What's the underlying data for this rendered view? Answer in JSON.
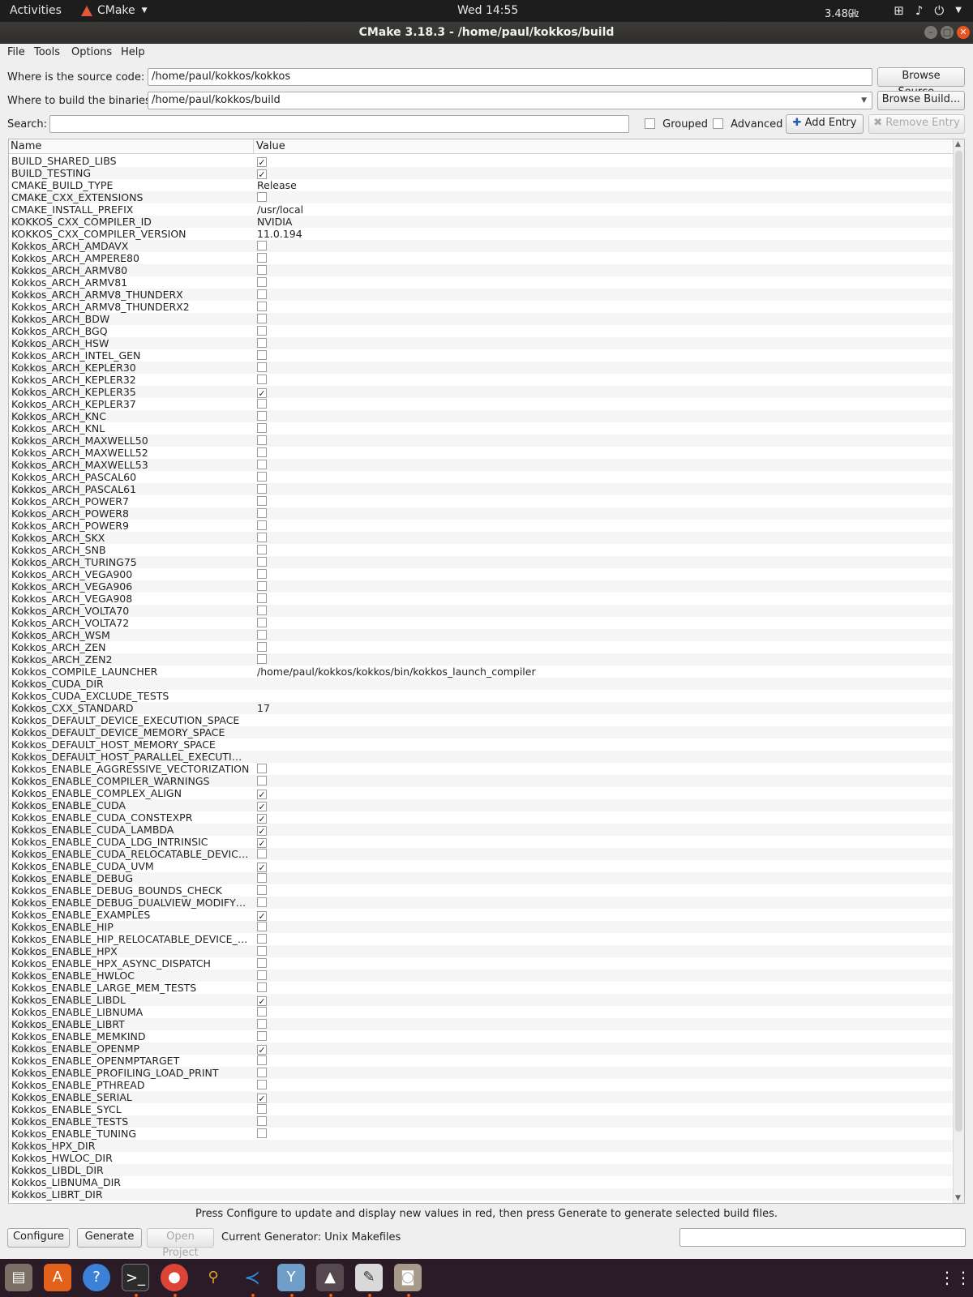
{
  "topbar": {
    "activities": "Activities",
    "app_name": "CMake",
    "clock": "Wed 14:55",
    "cpu": "3.48㎓",
    "tray_icons": [
      "network-icon",
      "volume-icon",
      "power-icon",
      "chevron-down-icon"
    ]
  },
  "window": {
    "title": "CMake 3.18.3 - /home/paul/kokkos/build"
  },
  "menu": [
    "File",
    "Tools",
    "Options",
    "Help"
  ],
  "source": {
    "label": "Where is the source code:",
    "value": "/home/paul/kokkos/kokkos",
    "browse": "Browse Source..."
  },
  "build": {
    "label": "Where to build the binaries:",
    "value": "/home/paul/kokkos/build",
    "browse": "Browse Build..."
  },
  "search": {
    "label": "Search:",
    "value": "",
    "grouped": "Grouped",
    "advanced": "Advanced",
    "add_entry": "Add Entry",
    "remove_entry": "Remove Entry"
  },
  "table": {
    "col_name": "Name",
    "col_value": "Value",
    "rows": [
      {
        "name": "BUILD_SHARED_LIBS",
        "type": "bool",
        "checked": true
      },
      {
        "name": "BUILD_TESTING",
        "type": "bool",
        "checked": true
      },
      {
        "name": "CMAKE_BUILD_TYPE",
        "type": "text",
        "value": "Release"
      },
      {
        "name": "CMAKE_CXX_EXTENSIONS",
        "type": "bool",
        "checked": false
      },
      {
        "name": "CMAKE_INSTALL_PREFIX",
        "type": "text",
        "value": "/usr/local"
      },
      {
        "name": "KOKKOS_CXX_COMPILER_ID",
        "type": "text",
        "value": "NVIDIA"
      },
      {
        "name": "KOKKOS_CXX_COMPILER_VERSION",
        "type": "text",
        "value": "11.0.194"
      },
      {
        "name": "Kokkos_ARCH_AMDAVX",
        "type": "bool",
        "checked": false
      },
      {
        "name": "Kokkos_ARCH_AMPERE80",
        "type": "bool",
        "checked": false
      },
      {
        "name": "Kokkos_ARCH_ARMV80",
        "type": "bool",
        "checked": false
      },
      {
        "name": "Kokkos_ARCH_ARMV81",
        "type": "bool",
        "checked": false
      },
      {
        "name": "Kokkos_ARCH_ARMV8_THUNDERX",
        "type": "bool",
        "checked": false
      },
      {
        "name": "Kokkos_ARCH_ARMV8_THUNDERX2",
        "type": "bool",
        "checked": false
      },
      {
        "name": "Kokkos_ARCH_BDW",
        "type": "bool",
        "checked": false
      },
      {
        "name": "Kokkos_ARCH_BGQ",
        "type": "bool",
        "checked": false
      },
      {
        "name": "Kokkos_ARCH_HSW",
        "type": "bool",
        "checked": false
      },
      {
        "name": "Kokkos_ARCH_INTEL_GEN",
        "type": "bool",
        "checked": false
      },
      {
        "name": "Kokkos_ARCH_KEPLER30",
        "type": "bool",
        "checked": false
      },
      {
        "name": "Kokkos_ARCH_KEPLER32",
        "type": "bool",
        "checked": false
      },
      {
        "name": "Kokkos_ARCH_KEPLER35",
        "type": "bool",
        "checked": true
      },
      {
        "name": "Kokkos_ARCH_KEPLER37",
        "type": "bool",
        "checked": false
      },
      {
        "name": "Kokkos_ARCH_KNC",
        "type": "bool",
        "checked": false
      },
      {
        "name": "Kokkos_ARCH_KNL",
        "type": "bool",
        "checked": false
      },
      {
        "name": "Kokkos_ARCH_MAXWELL50",
        "type": "bool",
        "checked": false
      },
      {
        "name": "Kokkos_ARCH_MAXWELL52",
        "type": "bool",
        "checked": false
      },
      {
        "name": "Kokkos_ARCH_MAXWELL53",
        "type": "bool",
        "checked": false
      },
      {
        "name": "Kokkos_ARCH_PASCAL60",
        "type": "bool",
        "checked": false
      },
      {
        "name": "Kokkos_ARCH_PASCAL61",
        "type": "bool",
        "checked": false
      },
      {
        "name": "Kokkos_ARCH_POWER7",
        "type": "bool",
        "checked": false
      },
      {
        "name": "Kokkos_ARCH_POWER8",
        "type": "bool",
        "checked": false
      },
      {
        "name": "Kokkos_ARCH_POWER9",
        "type": "bool",
        "checked": false
      },
      {
        "name": "Kokkos_ARCH_SKX",
        "type": "bool",
        "checked": false
      },
      {
        "name": "Kokkos_ARCH_SNB",
        "type": "bool",
        "checked": false
      },
      {
        "name": "Kokkos_ARCH_TURING75",
        "type": "bool",
        "checked": false
      },
      {
        "name": "Kokkos_ARCH_VEGA900",
        "type": "bool",
        "checked": false
      },
      {
        "name": "Kokkos_ARCH_VEGA906",
        "type": "bool",
        "checked": false
      },
      {
        "name": "Kokkos_ARCH_VEGA908",
        "type": "bool",
        "checked": false
      },
      {
        "name": "Kokkos_ARCH_VOLTA70",
        "type": "bool",
        "checked": false
      },
      {
        "name": "Kokkos_ARCH_VOLTA72",
        "type": "bool",
        "checked": false
      },
      {
        "name": "Kokkos_ARCH_WSM",
        "type": "bool",
        "checked": false
      },
      {
        "name": "Kokkos_ARCH_ZEN",
        "type": "bool",
        "checked": false
      },
      {
        "name": "Kokkos_ARCH_ZEN2",
        "type": "bool",
        "checked": false
      },
      {
        "name": "Kokkos_COMPILE_LAUNCHER",
        "type": "text",
        "value": "/home/paul/kokkos/kokkos/bin/kokkos_launch_compiler"
      },
      {
        "name": "Kokkos_CUDA_DIR",
        "type": "text",
        "value": ""
      },
      {
        "name": "Kokkos_CUDA_EXCLUDE_TESTS",
        "type": "text",
        "value": ""
      },
      {
        "name": "Kokkos_CXX_STANDARD",
        "type": "text",
        "value": "17"
      },
      {
        "name": "Kokkos_DEFAULT_DEVICE_EXECUTION_SPACE",
        "type": "text",
        "value": ""
      },
      {
        "name": "Kokkos_DEFAULT_DEVICE_MEMORY_SPACE",
        "type": "text",
        "value": ""
      },
      {
        "name": "Kokkos_DEFAULT_HOST_MEMORY_SPACE",
        "type": "text",
        "value": ""
      },
      {
        "name": "Kokkos_DEFAULT_HOST_PARALLEL_EXECUTION...",
        "type": "text",
        "value": ""
      },
      {
        "name": "Kokkos_ENABLE_AGGRESSIVE_VECTORIZATION",
        "type": "bool",
        "checked": false
      },
      {
        "name": "Kokkos_ENABLE_COMPILER_WARNINGS",
        "type": "bool",
        "checked": false
      },
      {
        "name": "Kokkos_ENABLE_COMPLEX_ALIGN",
        "type": "bool",
        "checked": true
      },
      {
        "name": "Kokkos_ENABLE_CUDA",
        "type": "bool",
        "checked": true
      },
      {
        "name": "Kokkos_ENABLE_CUDA_CONSTEXPR",
        "type": "bool",
        "checked": true
      },
      {
        "name": "Kokkos_ENABLE_CUDA_LAMBDA",
        "type": "bool",
        "checked": true
      },
      {
        "name": "Kokkos_ENABLE_CUDA_LDG_INTRINSIC",
        "type": "bool",
        "checked": true
      },
      {
        "name": "Kokkos_ENABLE_CUDA_RELOCATABLE_DEVICE_...",
        "type": "bool",
        "checked": false
      },
      {
        "name": "Kokkos_ENABLE_CUDA_UVM",
        "type": "bool",
        "checked": true
      },
      {
        "name": "Kokkos_ENABLE_DEBUG",
        "type": "bool",
        "checked": false
      },
      {
        "name": "Kokkos_ENABLE_DEBUG_BOUNDS_CHECK",
        "type": "bool",
        "checked": false
      },
      {
        "name": "Kokkos_ENABLE_DEBUG_DUALVIEW_MODIFY_C...",
        "type": "bool",
        "checked": false
      },
      {
        "name": "Kokkos_ENABLE_EXAMPLES",
        "type": "bool",
        "checked": true
      },
      {
        "name": "Kokkos_ENABLE_HIP",
        "type": "bool",
        "checked": false
      },
      {
        "name": "Kokkos_ENABLE_HIP_RELOCATABLE_DEVICE_C...",
        "type": "bool",
        "checked": false
      },
      {
        "name": "Kokkos_ENABLE_HPX",
        "type": "bool",
        "checked": false
      },
      {
        "name": "Kokkos_ENABLE_HPX_ASYNC_DISPATCH",
        "type": "bool",
        "checked": false
      },
      {
        "name": "Kokkos_ENABLE_HWLOC",
        "type": "bool",
        "checked": false
      },
      {
        "name": "Kokkos_ENABLE_LARGE_MEM_TESTS",
        "type": "bool",
        "checked": false
      },
      {
        "name": "Kokkos_ENABLE_LIBDL",
        "type": "bool",
        "checked": true
      },
      {
        "name": "Kokkos_ENABLE_LIBNUMA",
        "type": "bool",
        "checked": false
      },
      {
        "name": "Kokkos_ENABLE_LIBRT",
        "type": "bool",
        "checked": false
      },
      {
        "name": "Kokkos_ENABLE_MEMKIND",
        "type": "bool",
        "checked": false
      },
      {
        "name": "Kokkos_ENABLE_OPENMP",
        "type": "bool",
        "checked": true
      },
      {
        "name": "Kokkos_ENABLE_OPENMPTARGET",
        "type": "bool",
        "checked": false
      },
      {
        "name": "Kokkos_ENABLE_PROFILING_LOAD_PRINT",
        "type": "bool",
        "checked": false
      },
      {
        "name": "Kokkos_ENABLE_PTHREAD",
        "type": "bool",
        "checked": false
      },
      {
        "name": "Kokkos_ENABLE_SERIAL",
        "type": "bool",
        "checked": true
      },
      {
        "name": "Kokkos_ENABLE_SYCL",
        "type": "bool",
        "checked": false
      },
      {
        "name": "Kokkos_ENABLE_TESTS",
        "type": "bool",
        "checked": false
      },
      {
        "name": "Kokkos_ENABLE_TUNING",
        "type": "bool",
        "checked": false
      },
      {
        "name": "Kokkos_HPX_DIR",
        "type": "text",
        "value": ""
      },
      {
        "name": "Kokkos_HWLOC_DIR",
        "type": "text",
        "value": ""
      },
      {
        "name": "Kokkos_LIBDL_DIR",
        "type": "text",
        "value": ""
      },
      {
        "name": "Kokkos_LIBNUMA_DIR",
        "type": "text",
        "value": ""
      },
      {
        "name": "Kokkos_LIBRT_DIR",
        "type": "text",
        "value": ""
      }
    ]
  },
  "status": {
    "hint": "Press Configure to update and display new values in red, then press Generate to generate selected build files.",
    "configure": "Configure",
    "generate": "Generate",
    "open_project": "Open Project",
    "generator": "Current Generator: Unix Makefiles"
  },
  "dock": {
    "icons": [
      "files-icon",
      "software-center-icon",
      "help-icon",
      "terminal-icon",
      "chrome-icon",
      "magnifier-icon",
      "vscode-icon",
      "drink-icon",
      "cmake-icon",
      "text-editor-icon",
      "screenshot-icon"
    ]
  }
}
